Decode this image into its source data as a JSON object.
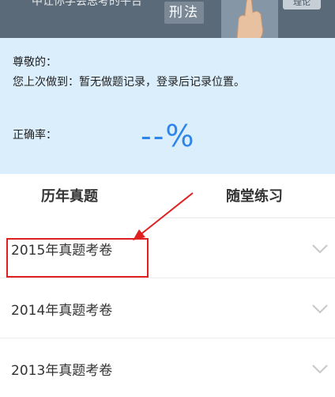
{
  "banner": {
    "slogan": "中让你学会思考的平台",
    "tag": "刑法",
    "chip": "理论"
  },
  "info": {
    "greeting": "尊敬的：",
    "last_record": "您上次做到：暂无做题记录，登录后记录位置。",
    "accuracy_label": "正确率：",
    "accuracy_value": "--%"
  },
  "tabs": [
    {
      "label": "历年真题",
      "active": true
    },
    {
      "label": "随堂练习",
      "active": false
    }
  ],
  "exams": [
    {
      "label": "2015年真题考卷"
    },
    {
      "label": "2014年真题考卷"
    },
    {
      "label": "2013年真题考卷"
    }
  ],
  "colors": {
    "banner_bg": "#5a6a78",
    "info_bg": "#dbeefc",
    "accent": "#2f86e8",
    "annotation": "#e02020"
  },
  "icons": {
    "row_toggle": "chevron-down-icon",
    "banner_image": "hand-icon"
  }
}
